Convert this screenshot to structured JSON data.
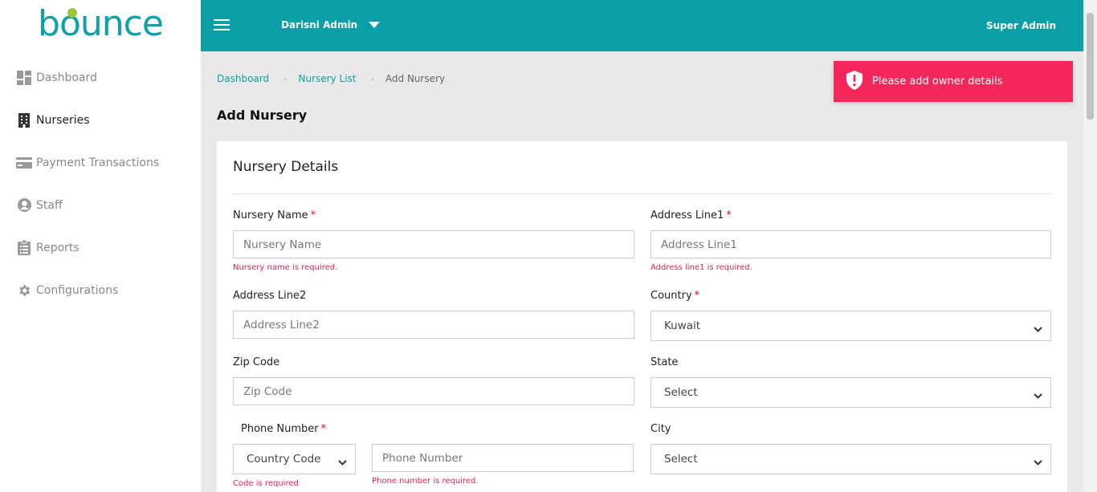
{
  "brand": {
    "logo_text": "bounce"
  },
  "sidebar": {
    "items": [
      {
        "label": "Dashboard",
        "icon": "dashboard-icon"
      },
      {
        "label": "Nurseries",
        "icon": "building-icon"
      },
      {
        "label": "Payment Transactions",
        "icon": "credit-card-icon"
      },
      {
        "label": "Staff",
        "icon": "user-circle-icon"
      },
      {
        "label": "Reports",
        "icon": "clipboard-icon"
      },
      {
        "label": "Configurations",
        "icon": "gear-icon"
      }
    ]
  },
  "topbar": {
    "account_name": "Darisni Admin",
    "role": "Super Admin"
  },
  "breadcrumb": {
    "items": [
      "Dashboard",
      "Nursery List",
      "Add Nursery"
    ]
  },
  "page": {
    "title": "Add Nursery"
  },
  "toast": {
    "message": "Please add owner details"
  },
  "form": {
    "section_title": "Nursery Details",
    "nursery_name": {
      "label": "Nursery Name",
      "placeholder": "Nursery Name",
      "error": "Nursery name is required."
    },
    "address_line1": {
      "label": "Address Line1",
      "placeholder": "Address Line1",
      "error": "Address line1 is required."
    },
    "address_line2": {
      "label": "Address Line2",
      "placeholder": "Address Line2"
    },
    "country": {
      "label": "Country",
      "value": "Kuwait"
    },
    "zip_code": {
      "label": "Zip Code",
      "placeholder": "Zip Code"
    },
    "state": {
      "label": "State",
      "value": "Select"
    },
    "phone": {
      "label": "Phone Number",
      "country_code_value": "Country Code",
      "placeholder": "Phone Number",
      "code_error": "Code is required",
      "number_error": "Phone number is required."
    },
    "city": {
      "label": "City",
      "value": "Select"
    }
  },
  "colors": {
    "primary": "#0a9fa7",
    "toast": "#f5275a",
    "error": "#e0234e"
  }
}
